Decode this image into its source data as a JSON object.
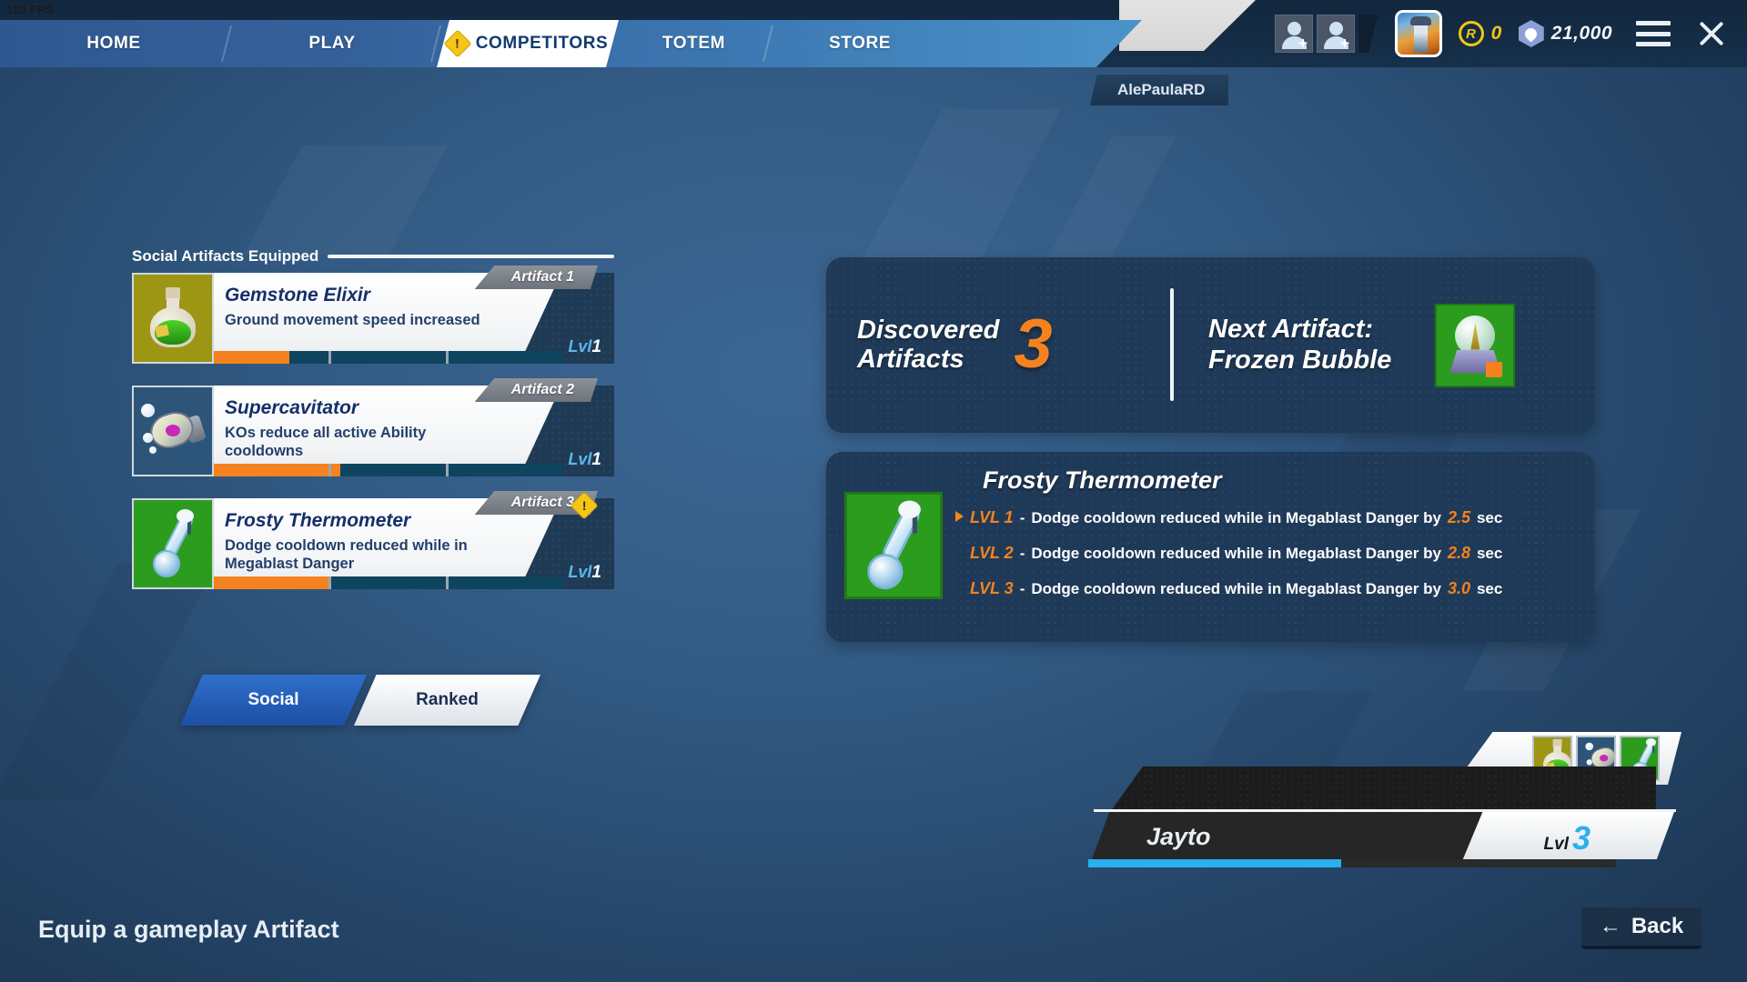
{
  "hud": {
    "fps": "120 FPS"
  },
  "nav": {
    "tabs": [
      {
        "label": "HOME",
        "active": false,
        "warn": false
      },
      {
        "label": "PLAY",
        "active": false,
        "warn": false
      },
      {
        "label": "COMPETITORS",
        "active": true,
        "warn": true
      },
      {
        "label": "TOTEM",
        "active": false,
        "warn": false
      },
      {
        "label": "STORE",
        "active": false,
        "warn": false
      }
    ]
  },
  "account": {
    "username": "AlePaulaRD",
    "coins": "0",
    "gems": "21,000"
  },
  "left": {
    "section_title": "Social Artifacts Equipped",
    "artifacts": [
      {
        "slot": "Artifact 1",
        "name": "Gemstone Elixir",
        "desc": "Ground movement speed increased",
        "level": "Lvl",
        "level_num": "1",
        "warn": false,
        "progress": [
          0.66,
          0,
          0
        ]
      },
      {
        "slot": "Artifact 2",
        "name": "Supercavitator",
        "desc": "KOs reduce all active Ability cooldowns",
        "level": "Lvl",
        "level_num": "1",
        "warn": false,
        "progress": [
          1.0,
          0.08,
          0
        ]
      },
      {
        "slot": "Artifact 3",
        "name": "Frosty Thermometer",
        "desc": "Dodge cooldown reduced while in Megablast Danger",
        "level": "Lvl",
        "level_num": "1",
        "warn": true,
        "progress": [
          1.0,
          0,
          0
        ]
      }
    ],
    "toggle": {
      "left": "Social",
      "right": "Ranked",
      "selected": "Social"
    }
  },
  "right": {
    "discovered": {
      "label_line1": "Discovered",
      "label_line2": "Artifacts",
      "count": "3"
    },
    "next": {
      "label_line1": "Next Artifact:",
      "label_line2": "Frozen Bubble"
    },
    "detail": {
      "title": "Frosty Thermometer",
      "levels": [
        {
          "label": "LVL 1",
          "dash": "-",
          "text_before": "Dodge cooldown reduced while in Megablast Danger by",
          "value": "2.5",
          "unit": "sec",
          "selected": true
        },
        {
          "label": "LVL 2",
          "dash": "-",
          "text_before": "Dodge cooldown reduced while in Megablast Danger by",
          "value": "2.8",
          "unit": "sec",
          "selected": false
        },
        {
          "label": "LVL 3",
          "dash": "-",
          "text_before": "Dodge cooldown reduced while in Megablast Danger by",
          "value": "3.0",
          "unit": "sec",
          "selected": false
        }
      ]
    }
  },
  "player": {
    "name": "Jayto",
    "level_label": "Lvl",
    "level_num": "3",
    "xp_percent": 48
  },
  "footer": {
    "hint": "Equip a gameplay Artifact",
    "back_label": "Back",
    "back_arrow": "←"
  },
  "colors": {
    "accent_orange": "#f5821f",
    "panel_navy": "#1f3a58",
    "active_blue": "#1d4fa4",
    "xp_cyan": "#29b0ee",
    "warn_yellow": "#f5c518"
  }
}
